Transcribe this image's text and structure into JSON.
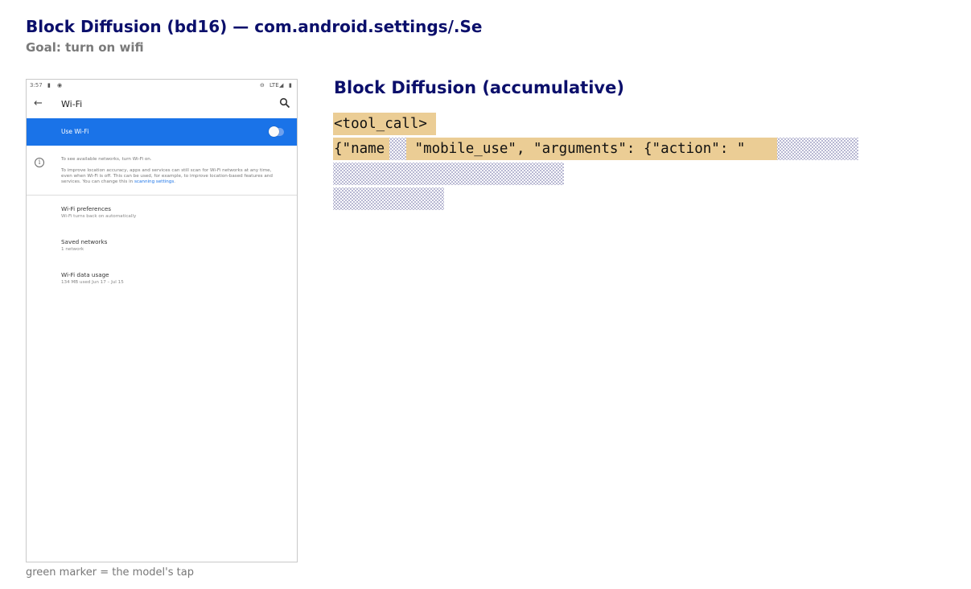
{
  "header": {
    "title": "Block Diffusion (bd16) — com.android.settings/.Se",
    "goal": "Goal: turn on wifi"
  },
  "phone": {
    "status_time": "3:57",
    "status_network": "LTE",
    "appbar_title": "Wi-Fi",
    "use_wifi_label": "Use Wi-Fi",
    "use_wifi_enabled": false,
    "info_line1": "To see available networks, turn Wi-Fi on.",
    "info_line2_prefix": "To improve location accuracy, apps and services can still scan for Wi-Fi networks at any time, even when Wi-Fi is off. This can be used, for example, to improve location-based features and services. You can change this in ",
    "info_link": "scanning settings",
    "info_line2_suffix": ".",
    "items": [
      {
        "primary": "Wi-Fi preferences",
        "secondary": "Wi-Fi turns back on automatically"
      },
      {
        "primary": "Saved networks",
        "secondary": "1 network"
      },
      {
        "primary": "Wi-Fi data usage",
        "secondary": "134 MB used Jun 17 – Jul 15"
      }
    ]
  },
  "footnote": "green marker = the model's tap",
  "panel": {
    "title": "Block Diffusion (accumulative)",
    "line1_token": "<tool_call>",
    "line2_token_a": "{\"name",
    "line2_token_b": " \"mobile_use\", \"arguments\": {\"action\": \""
  },
  "colors": {
    "title": "#0b0f6b",
    "filled_token": "#ebcd95",
    "masked_token_dots": "#a7a7c8",
    "wifi_bar": "#1a73e8"
  }
}
